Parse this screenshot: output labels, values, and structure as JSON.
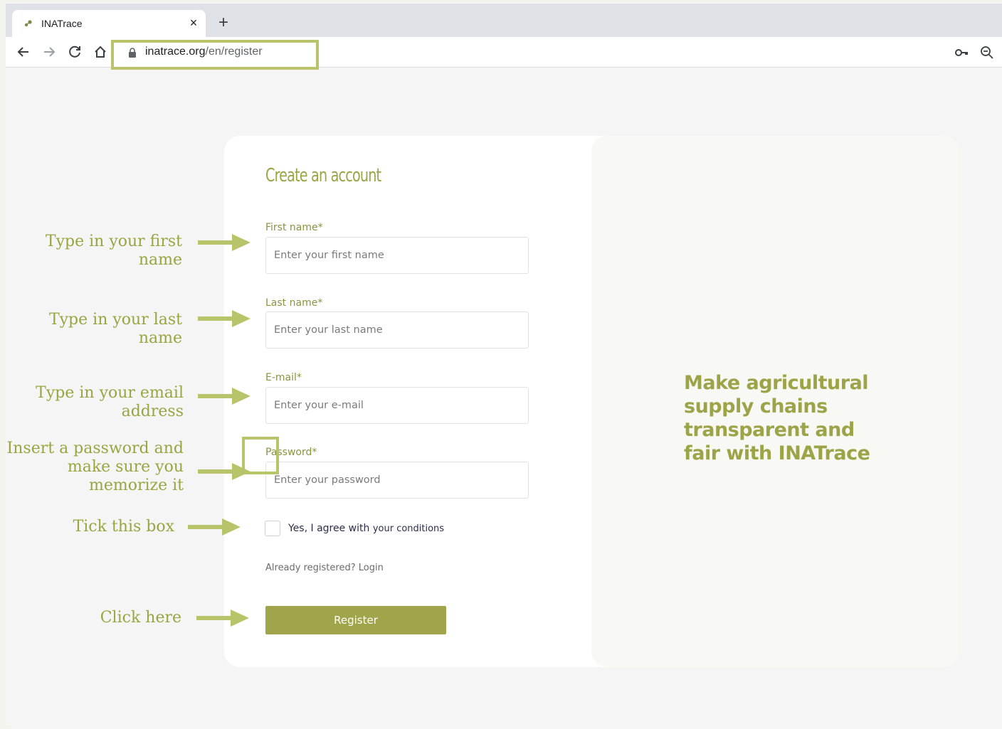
{
  "browser": {
    "tab_title": "INATrace",
    "close_glyph": "×",
    "new_tab_glyph": "+",
    "url_host": "inatrace.org",
    "url_path": "/en/register",
    "icons": [
      "back-icon",
      "forward-icon",
      "reload-icon",
      "home-icon",
      "lock-icon",
      "key-icon",
      "zoom-icon"
    ]
  },
  "form": {
    "title": "Create an account",
    "first_name": {
      "label": "First name*",
      "placeholder": "Enter your first name"
    },
    "last_name": {
      "label": "Last name*",
      "placeholder": "Enter your last name"
    },
    "email": {
      "label": "E-mail*",
      "placeholder": "Enter your e-mail"
    },
    "password": {
      "label": "Password*",
      "placeholder": "Enter your password"
    },
    "agree_text": "Yes, I agree with",
    "agree_link": "your conditions",
    "login_link": "Already registered? Login",
    "register_label": "Register"
  },
  "hero": {
    "tagline": "Make agricultural supply chains transparent and fair with INATrace"
  },
  "annotations": {
    "first_name": "Type in your first name",
    "last_name": "Type in your last name",
    "email": "Type in your email address",
    "password": "Insert a password and make sure you memorize it",
    "checkbox": "Tick this box",
    "register": "Click here"
  },
  "colors": {
    "accent": "#9da447",
    "annotation": "#9aa541",
    "button": "#a0a44b",
    "highlight": "#b9c46a"
  }
}
